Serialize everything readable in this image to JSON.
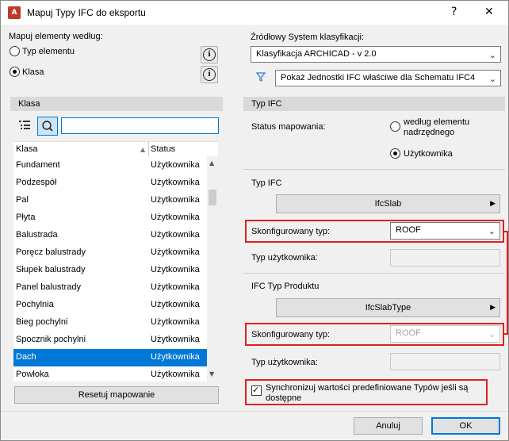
{
  "window": {
    "title": "Mapuj Typy IFC do eksportu",
    "help_label": "?",
    "close_label": "✕"
  },
  "left": {
    "map_by_label": "Mapuj elementy według:",
    "radio_type_label": "Typ elementu",
    "radio_class_label": "Klasa",
    "selected_radio": "Klasa",
    "class_header": "Klasa",
    "search_value": "",
    "columns": [
      "Klasa",
      "Status"
    ],
    "rows": [
      {
        "klasa": "Fundament",
        "status": "Użytkownika"
      },
      {
        "klasa": "Podzespół",
        "status": "Użytkownika"
      },
      {
        "klasa": "Pal",
        "status": "Użytkownika"
      },
      {
        "klasa": "Płyta",
        "status": "Użytkownika"
      },
      {
        "klasa": "Balustrada",
        "status": "Użytkownika"
      },
      {
        "klasa": "Poręcz balustrady",
        "status": "Użytkownika"
      },
      {
        "klasa": "Słupek balustrady",
        "status": "Użytkownika"
      },
      {
        "klasa": "Panel balustrady",
        "status": "Użytkownika"
      },
      {
        "klasa": "Pochylnia",
        "status": "Użytkownika"
      },
      {
        "klasa": "Bieg pochylni",
        "status": "Użytkownika"
      },
      {
        "klasa": "Spocznik pochylni",
        "status": "Użytkownika"
      },
      {
        "klasa": "Dach",
        "status": "Użytkownika"
      },
      {
        "klasa": "Powłoka",
        "status": "Użytkownika"
      }
    ],
    "selected_row": 11,
    "reset_button": "Resetuj mapowanie"
  },
  "right": {
    "source_label": "Źródłowy System klasyfikacji:",
    "source_value": "Klasyfikacja ARCHICAD - v 2.0",
    "filter_value": "Pokaż Jednostki IFC właściwe dla Schematu IFC4",
    "ifc_type_header": "Typ IFC",
    "status_label": "Status mapowania:",
    "status_opt1": "według elementu",
    "status_opt1b": "nadrzędnego",
    "status_opt2": "Użytkownika",
    "selected_status": "Użytkownika",
    "typ_ifc_label": "Typ IFC",
    "ifc_entity": "IfcSlab",
    "configured_label": "Skonfigurowany typ:",
    "configured_value": "ROOF",
    "user_type_label": "Typ użytkownika:",
    "product_label": "IFC Typ Produktu",
    "product_entity": "IfcSlabType",
    "configured2_label": "Skonfigurowany typ:",
    "configured2_value": "ROOF",
    "user_type2_label": "Typ użytkownika:",
    "sync_line1": "Synchronizuj wartości predefiniowane Typów jeśli są",
    "sync_line2": "dostępne",
    "sync_checked": true
  },
  "footer": {
    "cancel": "Anuluj",
    "ok": "OK"
  },
  "colors": {
    "accent": "#0078d7",
    "highlight_box": "#e02020"
  }
}
